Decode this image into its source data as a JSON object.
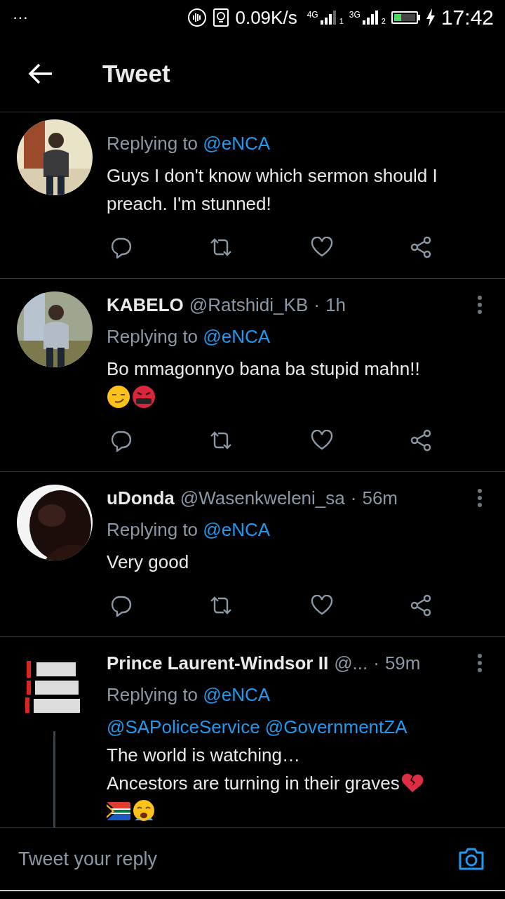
{
  "status_bar": {
    "menu": "···",
    "speed": "0.09K/s",
    "sim1_type": "4G",
    "sim1_index": "1",
    "sim2_type": "3G",
    "sim2_index": "2",
    "time": "17:42"
  },
  "header": {
    "title": "Tweet"
  },
  "tweets": [
    {
      "replying_label": "Replying to",
      "replying_to": "@eNCA",
      "lines": [
        {
          "kind": "text",
          "text": "Guys I don't know which sermon should I preach. I'm stunned!"
        }
      ],
      "thread": false
    },
    {
      "name": "KABELO",
      "handle": "@Ratshidi_KB",
      "separator": "·",
      "time": "1h",
      "replying_label": "Replying to",
      "replying_to": "@eNCA",
      "lines": [
        {
          "kind": "text",
          "text": "Bo mmagonnyo bana ba stupid mahn!!"
        },
        {
          "kind": "emoji"
        }
      ],
      "thread": false
    },
    {
      "name": "uDonda",
      "handle": "@Wasenkweleni_sa",
      "separator": "·",
      "time": "56m",
      "replying_label": "Replying to",
      "replying_to": "@eNCA",
      "lines": [
        {
          "kind": "text",
          "text": "Very good"
        }
      ],
      "thread": false
    },
    {
      "name": "Prince Laurent-Windsor II",
      "handle": "@...",
      "separator": "·",
      "time": "59m",
      "replying_label": "Replying to",
      "replying_to": "@eNCA",
      "lines": [
        {
          "kind": "mentions",
          "text": "@SAPoliceService @GovernmentZA"
        },
        {
          "kind": "text",
          "text": "The world is watching…"
        },
        {
          "kind": "text-emoji",
          "text": "Ancestors are turning in their graves"
        },
        {
          "kind": "emoji"
        }
      ],
      "thread": true
    }
  ],
  "reply_bar": {
    "placeholder": "Tweet your reply"
  }
}
